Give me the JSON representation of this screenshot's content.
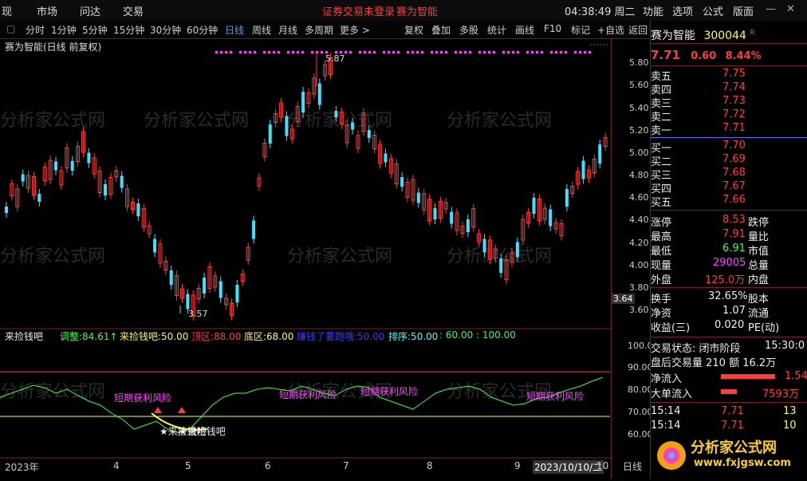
{
  "topbar": {
    "menus": [
      "现",
      "市场",
      "问达",
      "交易"
    ],
    "warning": "证券交易未登录",
    "stock_title": "赛为智能",
    "time": "04:38:49 周二",
    "right_menus": [
      "功能",
      "选项",
      "公式",
      "版面"
    ]
  },
  "toolbar": {
    "periods": [
      "分时",
      "1分钟",
      "5分钟",
      "15分钟",
      "30分钟",
      "60分钟",
      "日线",
      "周线",
      "月线",
      "多周期",
      "更多 >"
    ],
    "active": "日线",
    "tools": [
      "复权",
      "叠加",
      "多股",
      "统计",
      "画线",
      "F10",
      "标记",
      "+自选",
      "返回"
    ]
  },
  "chart": {
    "title": "赛为智能(日线 前复权)",
    "high_label": "5.87",
    "low_label": "3.57",
    "current_price_tag": "3.64",
    "yaxis_price": [
      "5.80",
      "5.60",
      "5.40",
      "5.20",
      "5.00",
      "4.80",
      "4.60",
      "4.40",
      "4.20",
      "4.00",
      "3.80",
      "3.60"
    ],
    "yaxis_ind": [
      "100.0",
      "90.00",
      "80.00",
      "70.00",
      "60.00"
    ],
    "xaxis": [
      "2023年",
      "4",
      "5",
      "6",
      "7",
      "8",
      "9",
      "2023/10/10/二",
      "10"
    ],
    "xaxis_right": "日线"
  },
  "indicator": {
    "name": "来捡钱吧",
    "items": [
      {
        "label": "调整:",
        "value": "84.61↑",
        "color": "#3cff3c"
      },
      {
        "label": "来捡钱吧:",
        "value": "50.00",
        "color": "#ffff3c"
      },
      {
        "label": "顶区:",
        "value": "88.00",
        "color": "#ff3c3c"
      },
      {
        "label": "底区:",
        "value": "68.00",
        "color": "#ffff3c"
      },
      {
        "label": "赚钱了要跑哦:",
        "value": "50.00",
        "color": "#3c3cff"
      },
      {
        "label": "排序:",
        "value": "50.00",
        "color": "#4ff"
      },
      {
        "label": "",
        "value": ": 60.00 : 100.00",
        "color": "#3cff3c"
      }
    ],
    "notes": [
      "短期获利风险",
      "短期获利风险",
      "短期获利风险",
      "短期获利风险"
    ],
    "buy_note": "★来捡钱吧"
  },
  "quote": {
    "name": "赛为智能",
    "code": "300044",
    "flag": "R",
    "price": "7.71",
    "change": "0.60",
    "pct": "8.44%",
    "asks": [
      {
        "label": "卖五",
        "price": "7.75"
      },
      {
        "label": "卖四",
        "price": "7.74"
      },
      {
        "label": "卖三",
        "price": "7.73"
      },
      {
        "label": "卖二",
        "price": "7.72"
      },
      {
        "label": "卖一",
        "price": "7.71"
      }
    ],
    "bids": [
      {
        "label": "买一",
        "price": "7.70"
      },
      {
        "label": "买二",
        "price": "7.69"
      },
      {
        "label": "买三",
        "price": "7.68"
      },
      {
        "label": "买四",
        "price": "7.67"
      },
      {
        "label": "买五",
        "price": "7.66"
      }
    ],
    "stats": [
      {
        "label": "涨停",
        "value": "8.53",
        "extra": "跌停",
        "color": "#ff3c3c"
      },
      {
        "label": "最高",
        "value": "7.91",
        "extra": "量比",
        "color": "#ff3c3c"
      },
      {
        "label": "最低",
        "value": "6.91",
        "extra": "市值",
        "color": "#3cff3c"
      },
      {
        "label": "现量",
        "value": "29005",
        "extra": "总量",
        "color": "#ff44ff"
      },
      {
        "label": "外盘",
        "value": "125.0万",
        "extra": "内盘",
        "color": "#ff3c3c"
      }
    ],
    "stats2": [
      {
        "label": "换手",
        "value": "32.65%",
        "extra": "股本"
      },
      {
        "label": "净资",
        "value": "1.07",
        "extra": "流通"
      },
      {
        "label": "收益(三)",
        "value": "0.020",
        "extra": "PE(动)"
      }
    ],
    "trade_status": "交易状态: 闭市阶段",
    "trade_time": "15:30:0",
    "after_hours": "盘后交易量 210 额 16.2万",
    "net_inflow_label": "净流入",
    "net_inflow_value": "1.54",
    "big_inflow_label": "大单流入",
    "big_inflow_value": "7593万",
    "ticks": [
      {
        "time": "15:14",
        "price": "7.71",
        "vol": "13"
      },
      {
        "time": "15:14",
        "price": "7.71",
        "vol": "10"
      }
    ]
  },
  "watermark": "分析家公式网",
  "logo_text": "分析家公式网",
  "logo_url": "www.fxjgsw.com"
}
